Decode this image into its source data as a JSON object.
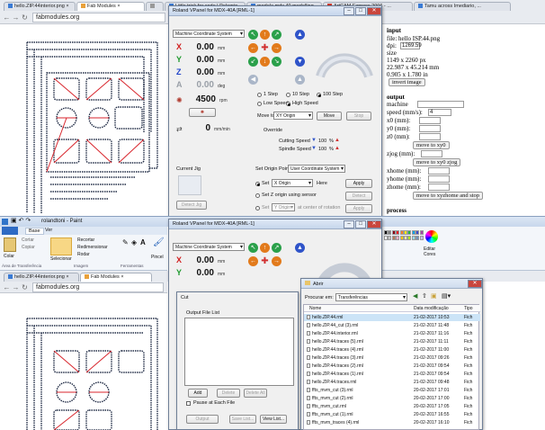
{
  "top_browser": {
    "tabs": [
      {
        "label": "hello.ZIP.44interior.png ×",
        "color": "#3a7bd5"
      },
      {
        "label": "Fab Modules ×",
        "color": "#e9a13b"
      },
      {
        "label": "",
        "color": "#999"
      },
      {
        "label": "Little trick for code | Pelegrin ...",
        "color": "#3a7bd5"
      },
      {
        "label": "modela mdx 40 modelling ...",
        "color": "#3a7bd5"
      },
      {
        "label": "ArtCAM Express 2006 - ...",
        "color": "#d23b2e"
      },
      {
        "label": "Tamu across Imediario, ...",
        "color": "#3a7bd5"
      }
    ],
    "address": "fabmodules.org"
  },
  "right_panel": {
    "input_heading": "input",
    "file_label": "file: hello ISP.44.png",
    "dpi_label": "dpi:",
    "dpi_value": "1269.59",
    "size_label": "size",
    "size_px": "1149 x 2260 px",
    "size_mm": "22.987 x 45.214 mm",
    "size_in": "0.905 x 1.780 in",
    "invert_label": "invert image",
    "output_heading": "output",
    "machine_label": "machine",
    "machine_value": "",
    "speed_label": "speed (mm/s):",
    "speed_value": "4",
    "x0_label": "x0 (mm):",
    "y0_label": "y0 (mm):",
    "z0_label": "z0 (mm):",
    "move_xy0": "move to xy0",
    "zjog_label": "zjog (mm):",
    "move_xy0zjog": "move to xy0 zjog",
    "xhome_label": "xhome (mm):",
    "yhome_label": "yhome (mm):",
    "zhome_label": "zhome (mm):",
    "move_home": "move to xyzhome and stop",
    "process_heading": "process"
  },
  "vpanel_top": {
    "title": "Roland VPanel for MDX-40A [RML-1]",
    "coord_system": "Machine Coordinate System",
    "axes": [
      {
        "name": "X",
        "value": "0.00",
        "unit": "mm",
        "color": "#d11f1f"
      },
      {
        "name": "Y",
        "value": "0.00",
        "unit": "mm",
        "color": "#1f9a2e"
      },
      {
        "name": "Z",
        "value": "0.00",
        "unit": "mm",
        "color": "#2043c9"
      },
      {
        "name": "A",
        "value": "0.00",
        "unit": "deg",
        "color": "#9aa0a8"
      }
    ],
    "spindle_value": "4500",
    "spindle_unit": "rpm",
    "feed_value": "0",
    "feed_unit": "mm/min",
    "steps": [
      "1 Step",
      "10 Step",
      "100 Step"
    ],
    "speeds": [
      "Low Speed",
      "High Speed"
    ],
    "move_to_label": "Move to",
    "move_to_value": "XY Origin",
    "move_btn": "Move",
    "stop_btn": "Stop",
    "override_label": "Override",
    "cutting_label": "Cutting Speed",
    "cutting_value": "100",
    "spindle_speed_label": "Spindle Speed",
    "spindle_speed_value": "100",
    "pct": "%",
    "current_jig": "Current Jig",
    "detect_jig": "Detect Jig",
    "set_origin_label": "Set Origin Point",
    "set_origin_value": "User Coordinate System",
    "apply": "Apply",
    "set_label": "Set",
    "set_value": "X Origin",
    "here": "Here",
    "set_z_label": "Set Z origin using sensor",
    "detect": "Detect",
    "set2_value": "Y Origin",
    "center_label": "at center of rotation",
    "apply2": "Apply"
  },
  "paint": {
    "title": "rolandtoni - Paint",
    "tabs": [
      "Base",
      "Ver"
    ],
    "colar": "Colar",
    "cortar": "Cortar",
    "copiar": "Copiar",
    "selecionar": "Selecionar",
    "recortar": "Recortar",
    "redimensionar": "Redimensionar",
    "rodar": "Rodar",
    "area_label": "Área de Transferência",
    "imagem_label": "Imagem",
    "ferramentas_label": "Ferramentas",
    "pincel": "Pincel",
    "editar_cores": "Editar Cores"
  },
  "bottom_browser": {
    "tabs": [
      {
        "label": "hello.ZIP.44interior.png ×",
        "color": "#3a7bd5"
      },
      {
        "label": "Fab Modules ×",
        "color": "#e9a13b"
      }
    ],
    "address": "fabmodules.org"
  },
  "vpanel_bottom": {
    "title": "Roland VPanel for MDX-40A [RML-1]",
    "coord_system": "Machine Coordinate System",
    "axes": [
      {
        "name": "X",
        "value": "0.00",
        "unit": "mm",
        "color": "#d11f1f"
      },
      {
        "name": "Y",
        "value": "0.00",
        "unit": "mm",
        "color": "#1f9a2e"
      }
    ]
  },
  "cut_dialog": {
    "title": "Cut",
    "list_label": "Output File List",
    "add": "Add",
    "delete": "Delete",
    "delete_all": "Delete All",
    "pause": "Pause at Each File",
    "output": "Output",
    "save_list": "Save List...",
    "view_list": "View List..."
  },
  "open_dialog": {
    "title": "Abrir",
    "look_in_label": "Procurar em:",
    "look_in_value": "Transferências",
    "col_name": "Nome",
    "col_date": "Data modificação",
    "col_type": "Tipo",
    "files": [
      {
        "name": "hello.ZIP.44.rml",
        "date": "21-02-2017 10:53",
        "type": "Fich"
      },
      {
        "name": "hello.ZIP.44_cut (3).rml",
        "date": "21-02-2017 11:48",
        "type": "Fich"
      },
      {
        "name": "hello.ZIP.44.interior.rml",
        "date": "21-02-2017 11:16",
        "type": "Fich"
      },
      {
        "name": "hello.ZIP.44.traces (5).rml",
        "date": "21-02-2017 11:11",
        "type": "Fich"
      },
      {
        "name": "hello.ZIP.44.traces (4).rml",
        "date": "21-02-2017 11:00",
        "type": "Fich"
      },
      {
        "name": "hello.ZIP.44.traces (3).rml",
        "date": "21-02-2017 09:26",
        "type": "Fich"
      },
      {
        "name": "hello.ZIP.44.traces (2).rml",
        "date": "21-02-2017 09:54",
        "type": "Fich"
      },
      {
        "name": "hello.ZIP.44.traces (1).rml",
        "date": "21-02-2017 09:54",
        "type": "Fich"
      },
      {
        "name": "hello.ZIP.44.traces.rml",
        "date": "21-02-2017 09:48",
        "type": "Fich"
      },
      {
        "name": "ffts_mvm_cut (3).rml",
        "date": "20-02-2017 17:01",
        "type": "Fich"
      },
      {
        "name": "ffts_mvm_cut (2).rml",
        "date": "20-02-2017 17:00",
        "type": "Fich"
      },
      {
        "name": "ffts_mvm_cut.rml",
        "date": "20-02-2017 17:05",
        "type": "Fich"
      },
      {
        "name": "ffts_mvm_cut (1).rml",
        "date": "20-02-2017 16:55",
        "type": "Fich"
      },
      {
        "name": "ffts_mvm_traces (4).rml",
        "date": "20-02-2017 16:10",
        "type": "Fich"
      }
    ]
  }
}
